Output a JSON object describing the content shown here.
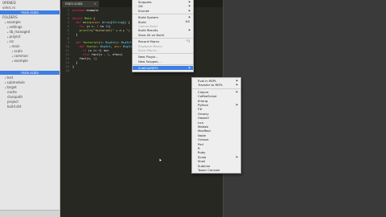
{
  "sidebar": {
    "top_rows": [
      {
        "label": "OPENED",
        "indent": 0,
        "caret": false
      },
      {
        "label": "vimrc.rs",
        "indent": 0,
        "caret": false
      },
      {
        "label": "main.scala",
        "indent": 0,
        "caret": false,
        "selected": true
      },
      {
        "label": "FOLDERS",
        "indent": 0,
        "caret": false
      },
      {
        "label": "example",
        "indent": 1,
        "caret": true
      },
      {
        "label": "settings",
        "indent": 2,
        "caret": true
      },
      {
        "label": "lib_managed",
        "indent": 2,
        "caret": true
      },
      {
        "label": "project",
        "indent": 2,
        "caret": true
      },
      {
        "label": "src",
        "indent": 2,
        "caret": true
      },
      {
        "label": "main",
        "indent": 3,
        "caret": true
      },
      {
        "label": "scala",
        "indent": 4,
        "caret": true
      },
      {
        "label": "common",
        "indent": 4,
        "caret": true
      },
      {
        "label": "example",
        "indent": 4,
        "caret": true
      },
      {
        "label": "main.scala",
        "indent": 0,
        "caret": false,
        "selected": true
      },
      {
        "label": "test",
        "indent": 1,
        "caret": true
      },
      {
        "label": "submodule",
        "indent": 1,
        "caret": true
      },
      {
        "label": "target",
        "indent": 1,
        "caret": true
      },
      {
        "label": "cache",
        "indent": 2,
        "caret": false
      },
      {
        "label": "classpath",
        "indent": 2,
        "caret": false
      },
      {
        "label": "project",
        "indent": 2,
        "caret": false
      },
      {
        "label": "build.sbt",
        "indent": 2,
        "caret": false
      }
    ]
  },
  "editor": {
    "tab_label": "main.scala",
    "tab_close": "×",
    "line_numbers": [
      "1",
      "2",
      "3",
      "4",
      "5",
      "6",
      "7",
      "8",
      "9",
      "10",
      "11",
      "12",
      "13",
      "14",
      "15",
      "16"
    ]
  },
  "file_menu": {
    "items": [
      {
        "label": "Snippets",
        "sub": true
      },
      {
        "label": "Git",
        "sub": true
      },
      {
        "label": "Emmet",
        "sub": true
      },
      {
        "sep": true
      },
      {
        "label": "Build System",
        "sub": true
      },
      {
        "label": "Build",
        "shortcut": "⌘B"
      },
      {
        "label": "Cancel Build",
        "disabled": true
      },
      {
        "label": "Build Results",
        "sub": true
      },
      {
        "label": "Save All on Build"
      },
      {
        "sep": true
      },
      {
        "label": "Record Macro",
        "shortcut": "^Q"
      },
      {
        "label": "Playback Macro",
        "disabled": true
      },
      {
        "label": "Save Macro…",
        "disabled": true
      },
      {
        "sep": true
      },
      {
        "label": "New Plugin…"
      },
      {
        "label": "New Snippet…"
      },
      {
        "sep": true
      },
      {
        "label": "SublimeREPL",
        "sub": true,
        "highlighted": true
      }
    ]
  },
  "repl_menu": {
    "items": [
      {
        "label": "Eval in REPL",
        "sub": true
      },
      {
        "label": "Transfer to REPL",
        "sub": true
      },
      {
        "sep": true
      },
      {
        "label": "Clojure",
        "sub": true
      },
      {
        "label": "CoffeeScript"
      },
      {
        "label": "Erlang"
      },
      {
        "label": "Python",
        "sub": true
      },
      {
        "label": "F#"
      },
      {
        "label": "Groovy"
      },
      {
        "label": "Haskell"
      },
      {
        "label": "Lua"
      },
      {
        "label": "Matlab"
      },
      {
        "label": "MozRepl"
      },
      {
        "label": "Node"
      },
      {
        "label": "Octave"
      },
      {
        "label": "Perl"
      },
      {
        "label": "R"
      },
      {
        "label": "Ruby"
      },
      {
        "label": "Scala",
        "sub": true
      },
      {
        "label": "Shell"
      },
      {
        "label": "Sublime"
      },
      {
        "label": "Tower Console"
      }
    ]
  }
}
